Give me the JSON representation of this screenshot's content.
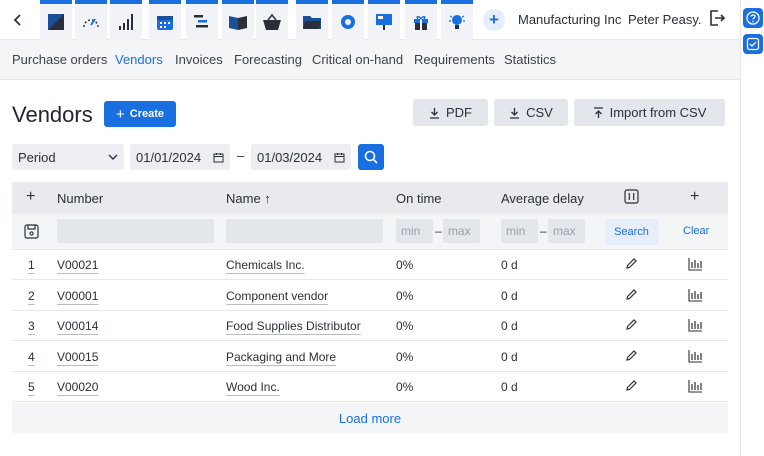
{
  "header": {
    "company": "Manufacturing Inc",
    "user": "Peter Peasy.",
    "apps": [
      "analytics-icon",
      "gauge-icon",
      "signal-bars-icon",
      "calendar-icon",
      "gantt-icon",
      "book-icon",
      "basket-icon",
      "folder-icon",
      "gear-icon",
      "presentation-icon",
      "gift-icon",
      "lightbulb-icon"
    ]
  },
  "subnav": {
    "items": [
      "Purchase orders",
      "Vendors",
      "Invoices",
      "Forecasting",
      "Critical on-hand",
      "Requirements",
      "Statistics"
    ],
    "active": "Vendors"
  },
  "page": {
    "title": "Vendors",
    "create_label": "Create",
    "pdf_label": "PDF",
    "csv_label": "CSV",
    "import_label": "Import from CSV"
  },
  "filters": {
    "period_label": "Period",
    "date_from": "01/01/2024",
    "date_sep": "–",
    "date_to": "01/03/2024"
  },
  "table": {
    "columns": {
      "add": "+",
      "number": "Number",
      "name": "Name ↑",
      "on_time": "On time",
      "avg_delay": "Average delay",
      "add_col": "+"
    },
    "filter_row": {
      "min_placeholder": "min",
      "max_placeholder": "max",
      "sep": "–",
      "search_label": "Search",
      "clear_label": "Clear"
    },
    "rows": [
      {
        "index": "1",
        "number": "V00021",
        "name": "Chemicals Inc.",
        "on_time": "0%",
        "delay": "0 d"
      },
      {
        "index": "2",
        "number": "V00001",
        "name": "Component vendor",
        "on_time": "0%",
        "delay": "0 d"
      },
      {
        "index": "3",
        "number": "V00014",
        "name": "Food Supplies Distributor",
        "on_time": "0%",
        "delay": "0 d"
      },
      {
        "index": "4",
        "number": "V00015",
        "name": "Packaging and More",
        "on_time": "0%",
        "delay": "0 d"
      },
      {
        "index": "5",
        "number": "V00020",
        "name": "Wood Inc.",
        "on_time": "0%",
        "delay": "0 d"
      }
    ],
    "load_more": "Load more"
  },
  "colors": {
    "accent": "#1a6fe0",
    "header_bg": "#e8eaee",
    "button_grey": "#e3e6ea"
  }
}
